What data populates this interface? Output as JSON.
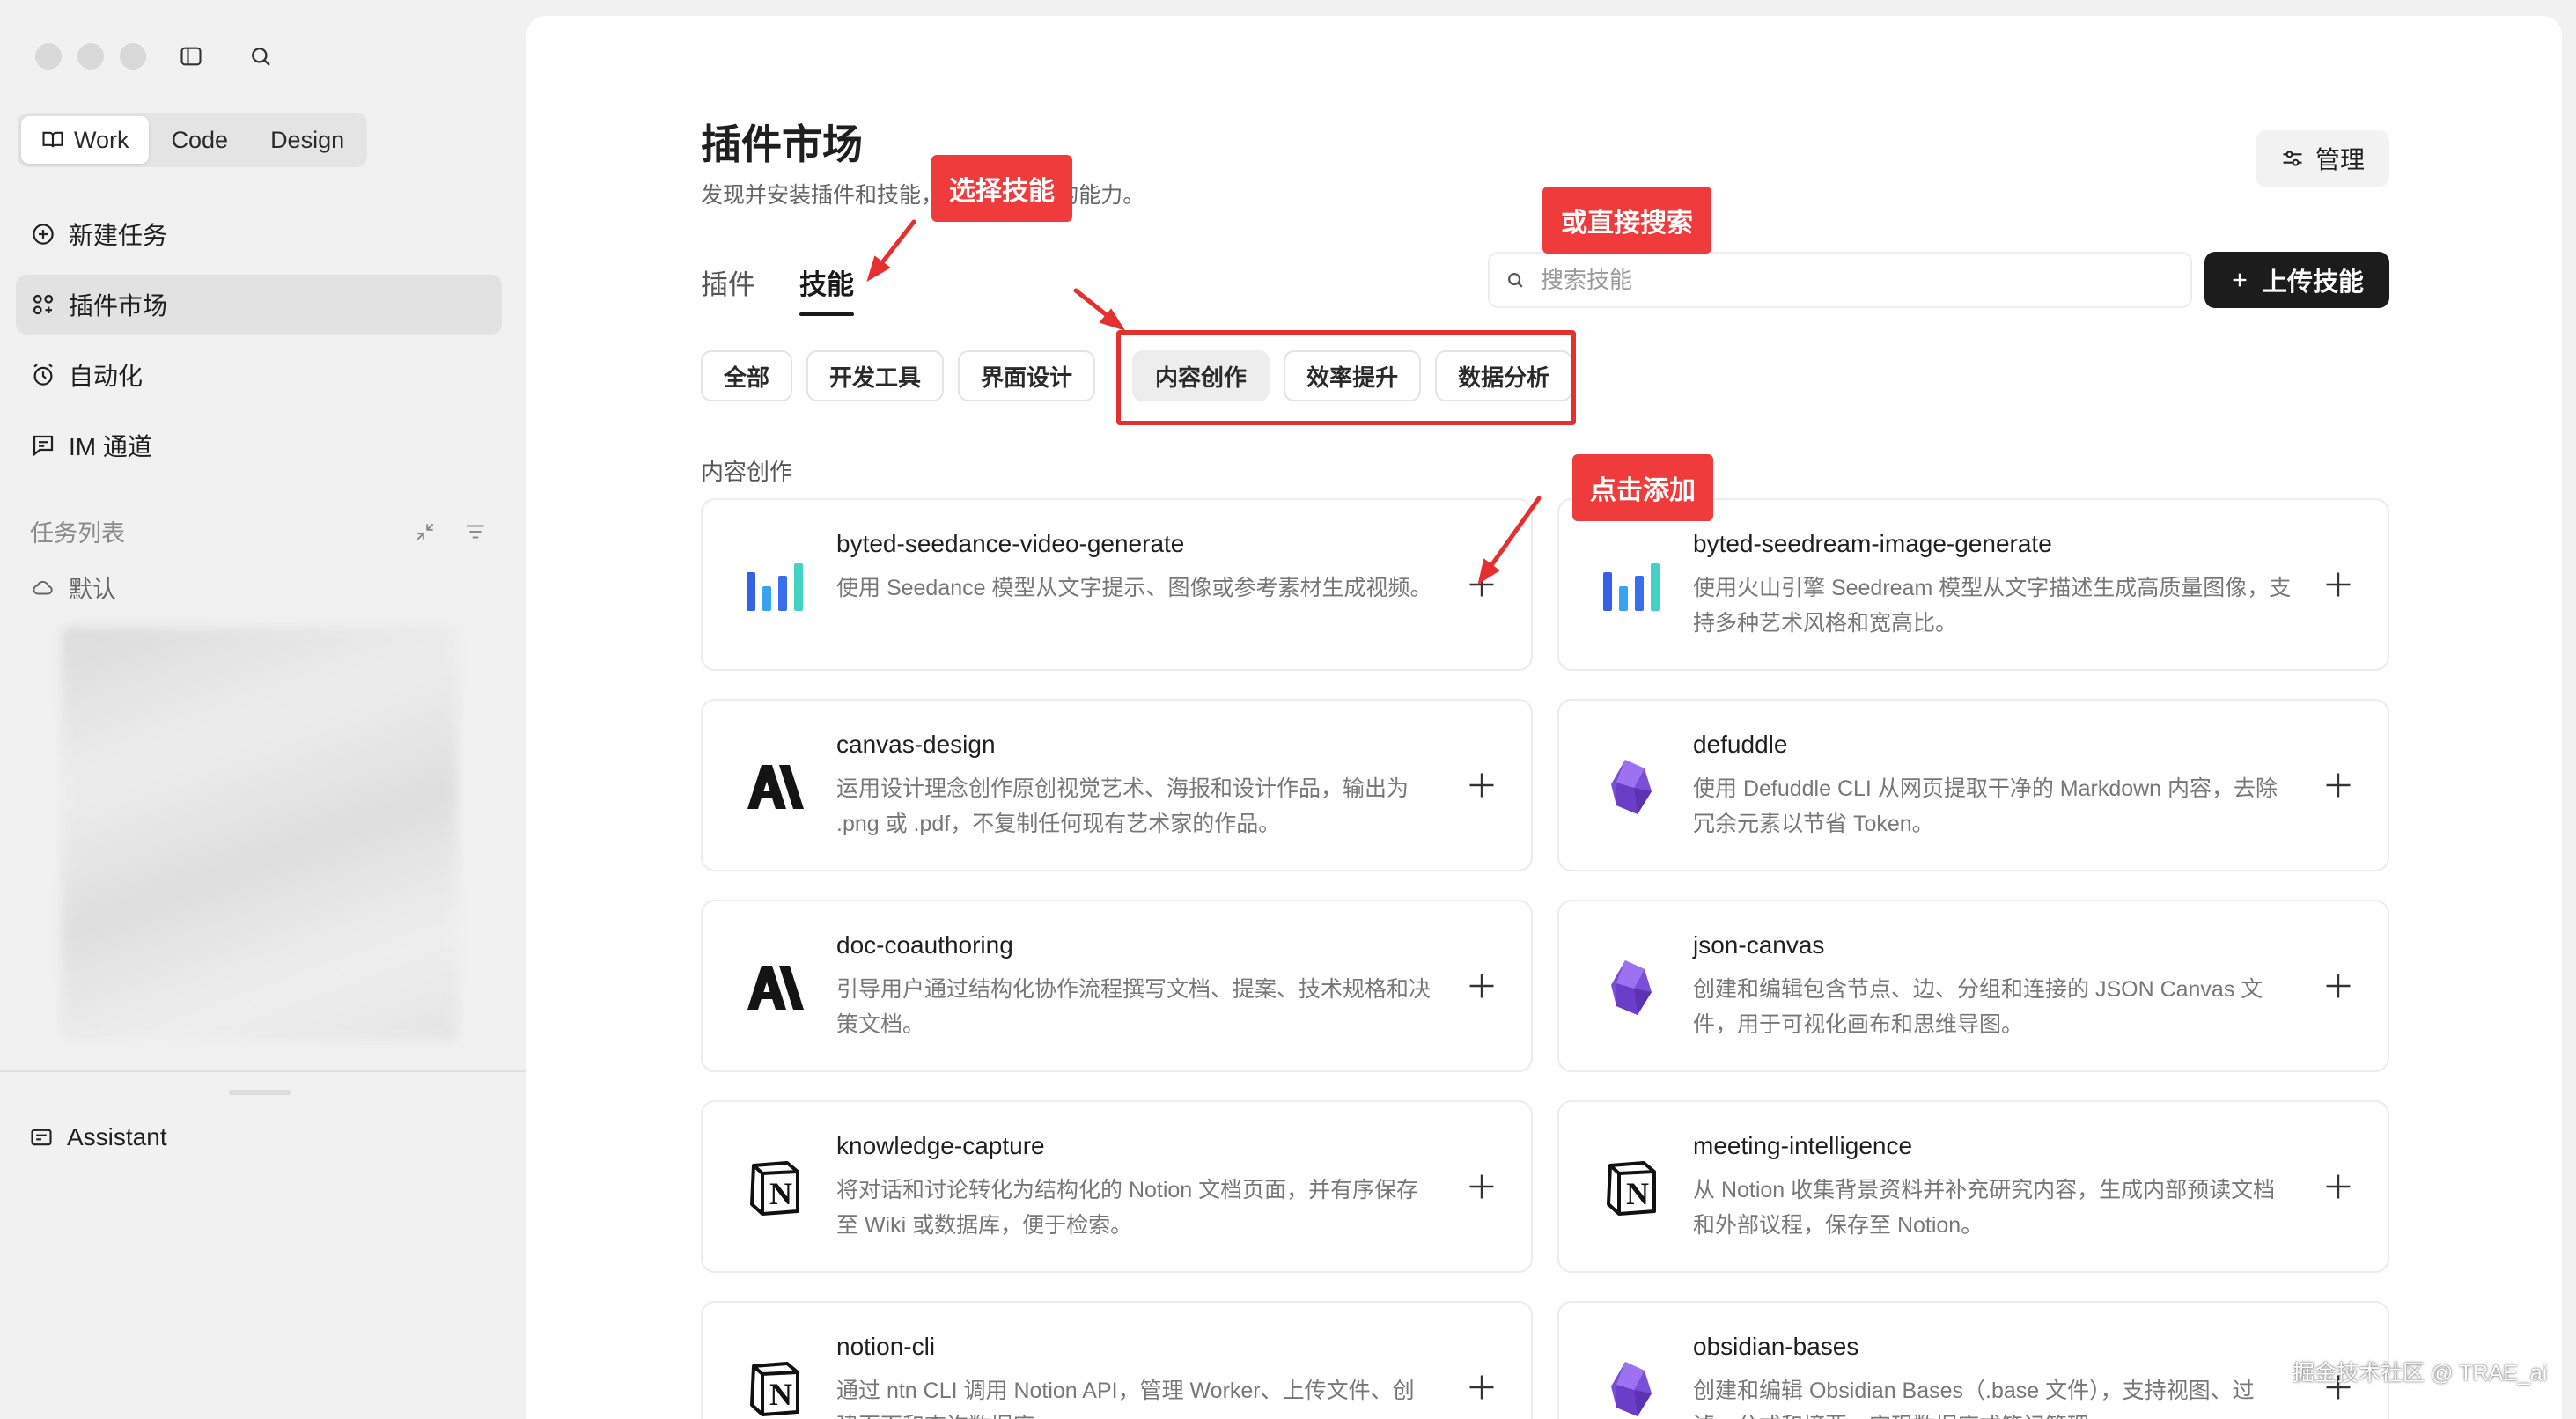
{
  "sidebar": {
    "modes": [
      "Work",
      "Code",
      "Design"
    ],
    "nav": [
      "新建任务",
      "插件市场",
      "自动化",
      "IM 通道"
    ],
    "tasks_heading": "任务列表",
    "default_item": "默认",
    "assistant": "Assistant"
  },
  "main": {
    "title": "插件市场",
    "subtitle": "发现并安装插件和技能，扩展 Agent 的能力。",
    "manage_label": "管理",
    "tabs": [
      "插件",
      "技能"
    ],
    "search_placeholder": "搜索技能",
    "upload_label": "上传技能",
    "chips": [
      "全部",
      "开发工具",
      "界面设计",
      "内容创作",
      "效率提升",
      "数据分析"
    ],
    "section_label": "内容创作",
    "cards": [
      {
        "name": "byted-seedance-video-generate",
        "desc": "使用 Seedance 模型从文字提示、图像或参考素材生成视频。",
        "logo": "bars-logo"
      },
      {
        "name": "byted-seedream-image-generate",
        "desc": "使用火山引擎 Seedream 模型从文字描述生成高质量图像，支持多种艺术风格和宽高比。",
        "logo": "bars-logo"
      },
      {
        "name": "canvas-design",
        "desc": "运用设计理念创作原创视觉艺术、海报和设计作品，输出为 .png 或 .pdf，不复制任何现有艺术家的作品。",
        "logo": "anthropic-logo"
      },
      {
        "name": "defuddle",
        "desc": "使用 Defuddle CLI 从网页提取干净的 Markdown 内容，去除冗余元素以节省 Token。",
        "logo": "obsidian-logo"
      },
      {
        "name": "doc-coauthoring",
        "desc": "引导用户通过结构化协作流程撰写文档、提案、技术规格和决策文档。",
        "logo": "anthropic-logo"
      },
      {
        "name": "json-canvas",
        "desc": "创建和编辑包含节点、边、分组和连接的 JSON Canvas 文件，用于可视化画布和思维导图。",
        "logo": "obsidian-logo"
      },
      {
        "name": "knowledge-capture",
        "desc": "将对话和讨论转化为结构化的 Notion 文档页面，并有序保存至 Wiki 或数据库，便于检索。",
        "logo": "notion-logo"
      },
      {
        "name": "meeting-intelligence",
        "desc": "从 Notion 收集背景资料并补充研究内容，生成内部预读文档和外部议程，保存至 Notion。",
        "logo": "notion-logo"
      },
      {
        "name": "notion-cli",
        "desc": "通过 ntn CLI 调用 Notion API，管理 Worker、上传文件、创建页面和查询数据库。",
        "logo": "notion-logo"
      },
      {
        "name": "obsidian-bases",
        "desc": "创建和编辑 Obsidian Bases（.base 文件），支持视图、过滤、公式和摘要，实现数据库式笔记管理。",
        "logo": "obsidian-logo"
      }
    ]
  },
  "annotations": {
    "select_skill": "选择技能",
    "search_direct": "或直接搜索",
    "click_add": "点击添加"
  },
  "watermark": "掘金技术社区 @ TRAE_ai",
  "colors": {
    "annotation_red": "#ef3b3b",
    "primary_dark": "#1c1c1c"
  }
}
